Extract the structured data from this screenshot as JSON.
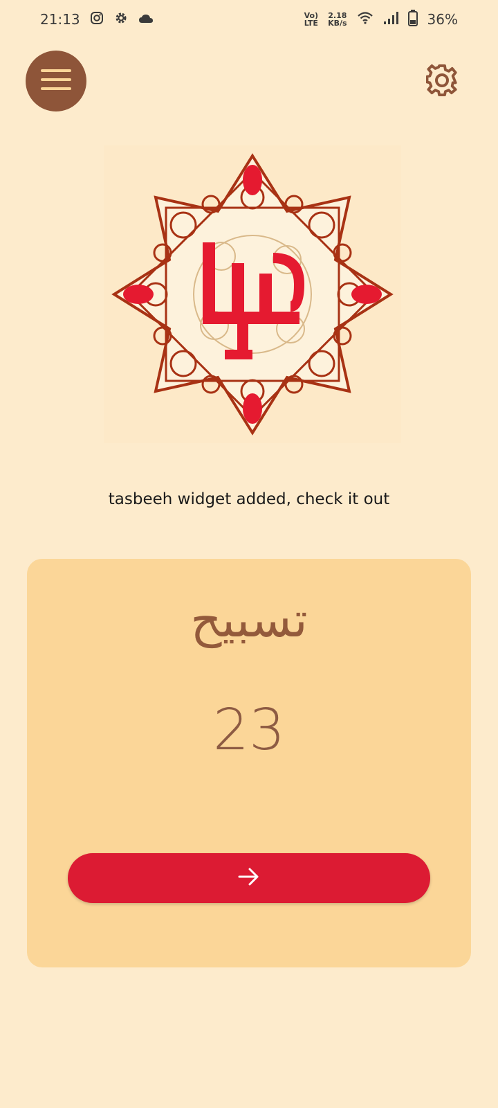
{
  "status_bar": {
    "time": "21:13",
    "network_top": "Vo)",
    "network_bottom": "LTE",
    "speed_value": "2.18",
    "speed_unit": "KB/s",
    "battery": "36%"
  },
  "icons": {
    "menu": "hamburger-menu-icon",
    "settings": "gear-icon",
    "next": "arrow-right-icon"
  },
  "colors": {
    "background": "#fdebcc",
    "card": "#fbd698",
    "accent_brown": "#8e5539",
    "button_red": "#dc1b33"
  },
  "toast": {
    "text": "tasbeeh widget added, check it out"
  },
  "card": {
    "title": "تسبيح",
    "count": "23"
  }
}
